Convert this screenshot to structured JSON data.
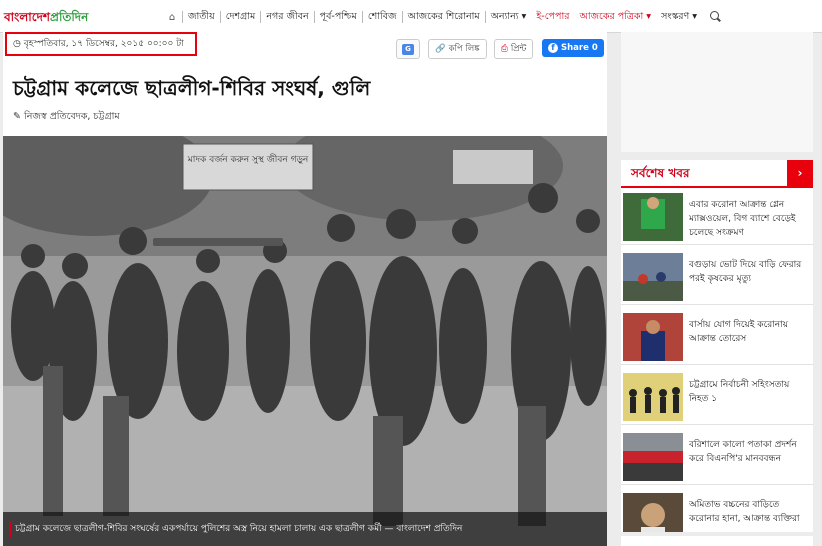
{
  "site": {
    "logo_part1": "বাংলাদেশ",
    "logo_part2": "প্রতিদিন"
  },
  "nav": {
    "home_icon": "home-icon",
    "items": [
      "জাতীয়",
      "দেশগ্রাম",
      "নগর জীবন",
      "পূর্ব-পশ্চিম",
      "শোবিজ",
      "আজকের শিরোনাম",
      "অন্যান্য ▾",
      "ই-পেপার",
      "আজকের পত্রিকা ▾",
      "সংস্করণ ▾"
    ],
    "search_icon": "search-icon"
  },
  "article": {
    "date": "বৃহস্পতিবার, ১৭ ডিসেম্বর, ২০১৫ ০০:০০ টা",
    "clock_icon": "clock-icon",
    "headline": "চট্টগ্রাম কলেজে ছাত্রলীগ-শিবির সংঘর্ষ, গুলি",
    "byline": "নিজস্ব প্রতিবেদক, চট্টগ্রাম",
    "copy_link": "কপি লিঙ্ক",
    "print": "প্রিন্ট",
    "share": "Share 0",
    "caption": "চট্টগ্রাম কলেজে ছাত্রলীগ-শিবির সংঘর্ষের একপর্যায়ে পুলিশের অস্ত্র নিয়ে হামলা চালায় এক ছাত্রলীগ কর্মী — বাংলাদেশ প্রতিদিন",
    "photo_banner": "মাদক বর্জন করুন সুস্থ জীবন গড়ুন"
  },
  "latest": {
    "title": "সর্বশেষ খবর",
    "items": [
      {
        "text": "এবার করোনা আক্রান্ত গ্লেন ম্যাক্সওয়েল, বিগ ব্যাশে বেড়েই চলেছে সংক্রমণ"
      },
      {
        "text": "বগুড়ায় ভোট দিয়ে বাড়ি ফেরার পরই কৃষকের মৃত্যু"
      },
      {
        "text": "বার্সায় যোগ দিয়েই করোনায় আক্রান্ত তোরেস"
      },
      {
        "text": "চট্টগ্রামে নির্বাচনী সহিংসতায় নিহত ১"
      },
      {
        "text": "বরিশালে কালো পতাকা প্রদর্শন করে বিএনপি'র মানববন্ধন"
      },
      {
        "text": "অমিতাভ বচ্চনের বাড়িতে করোনার হানা, আক্রান্ত ব্যক্তিরা"
      }
    ]
  },
  "colors": {
    "accent": "#e8000d",
    "brand_green": "#2e9e3e",
    "facebook": "#1877f2"
  }
}
